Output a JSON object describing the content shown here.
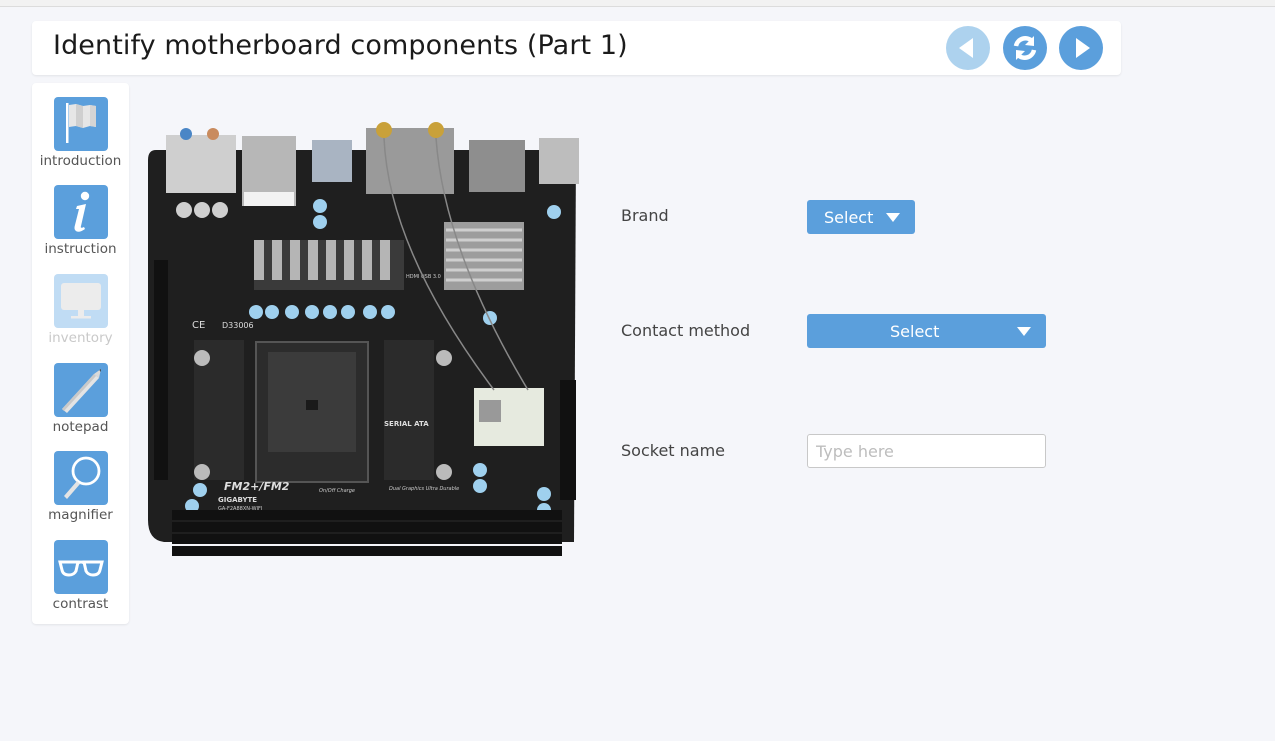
{
  "header": {
    "title": "Identify motherboard components (Part 1)",
    "nav": [
      {
        "name": "back",
        "icon": "arrow-left-icon",
        "enabled": false
      },
      {
        "name": "reset",
        "icon": "refresh-icon",
        "enabled": true
      },
      {
        "name": "forward",
        "icon": "arrow-right-icon",
        "enabled": true
      }
    ]
  },
  "sidebar": {
    "tools": [
      {
        "label": "introduction",
        "icon": "flag-icon",
        "enabled": true
      },
      {
        "label": "instruction",
        "icon": "info-icon",
        "enabled": true
      },
      {
        "label": "inventory",
        "icon": "monitor-icon",
        "enabled": false
      },
      {
        "label": "notepad",
        "icon": "pencil-icon",
        "enabled": true
      },
      {
        "label": "magnifier",
        "icon": "magnifier-icon",
        "enabled": true
      },
      {
        "label": "contrast",
        "icon": "glasses-icon",
        "enabled": true
      }
    ]
  },
  "image": {
    "alt": "Mini-ITX motherboard",
    "board_labels": {
      "socket_label": "FM2+/FM2",
      "brand_label": "GIGABYTE",
      "model_label": "GA-F2A88XN-WIFI",
      "sata_label": "SERIAL ATA",
      "ce_code": "D33006",
      "hdmi_label": "HDMI USB 3.0",
      "dual_graphics": "Dual Graphics Ultra Durable",
      "onoff": "On/Off Charge"
    }
  },
  "form": {
    "fields": [
      {
        "label": "Brand",
        "type": "select",
        "value": "Select"
      },
      {
        "label": "Contact method",
        "type": "select",
        "value": "Select"
      },
      {
        "label": "Socket name",
        "type": "text",
        "value": "",
        "placeholder": "Type here"
      }
    ]
  },
  "colors": {
    "accent": "#5b9fdc",
    "accent_disabled": "#add2ee",
    "background": "#f5f6fa",
    "panel": "#ffffff"
  }
}
